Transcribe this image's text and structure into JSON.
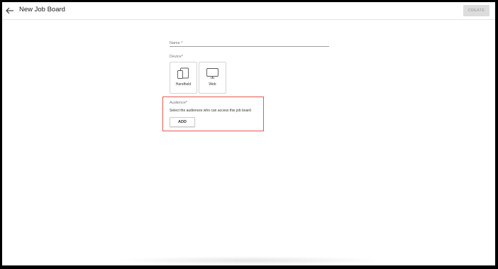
{
  "header": {
    "title": "New Job Board",
    "create_label": "CREATE",
    "back_icon": "arrow-left-icon"
  },
  "form": {
    "name_label": "Name *",
    "device_label": "Device*",
    "devices": [
      {
        "label": "Handheld",
        "icon": "handheld-devices-icon"
      },
      {
        "label": "Web",
        "icon": "monitor-icon"
      }
    ],
    "audience": {
      "label": "Audience*",
      "help": "Select the audiences who can access this job board",
      "add_label": "ADD"
    }
  },
  "colors": {
    "highlight": "#e8584f",
    "disabled_button_bg": "#dcdcdc"
  }
}
